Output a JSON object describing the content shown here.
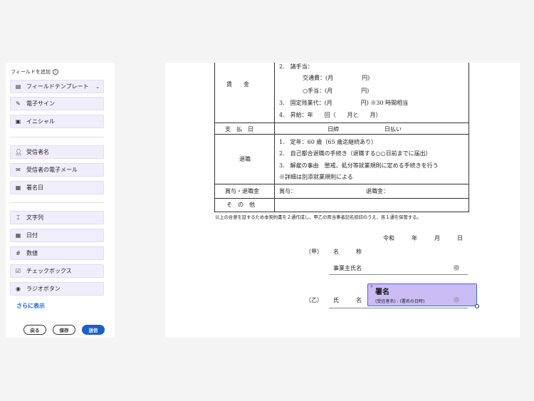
{
  "panel": {
    "title": "フィールドを追加",
    "template": "フィールドテンプレート",
    "items1": [
      "電子サイン",
      "イニシャル"
    ],
    "items2": [
      "受信者名",
      "受信者の電子メール",
      "署名日"
    ],
    "items3": [
      "文字列",
      "日付",
      "数値",
      "チェックボックス",
      "ラジオボタン"
    ],
    "more": "さらに表示",
    "back": "戻る",
    "save": "保存",
    "send": "送信",
    "accent": "#1a5fc9"
  },
  "doc": {
    "wage_label": "賃　　金",
    "wage_lines": [
      "2.　諸手当：",
      "交通費：(月　　　　　円)",
      "○手当：(月　　　　　円)",
      "3.　固定残業代：(月　　　　　円) ※30 時間相当",
      "4.　昇給：年　　回（　　月と　　月）"
    ],
    "pay_label": "支　払　日",
    "pay_close": "日締",
    "pay_day": "日払い",
    "retire_label": "退職",
    "retire_lines": [
      "1.　定年：60 歳（65 歳迄継続あり）",
      "2.　自己都合退職の手続き（退職する○○日前までに届出）",
      "3.　解雇の事由　懲戒、処分等就業規則に定める手続きを行う",
      "※詳細は別添就業規則による"
    ],
    "bonus_label": "賞与・退職金",
    "bonus": "賞与：",
    "severance": "退職金：",
    "other_label": "そ　の　他",
    "note": "以上の合意を証するため本契約書を２通作成し、甲乙の両当事者記名捺印のうえ、各１通を保管する。",
    "date": "令和　　　年　　　月　　　日",
    "party_a": "（甲）",
    "name_a": "名　　　称",
    "employer": "事業主氏名",
    "seal": "㊞",
    "party_b": "（乙）",
    "name_b": "氏　　　名"
  },
  "sig_field": {
    "required": "*",
    "title": "署名",
    "sub": "(受信者名) : (署名の日時)"
  }
}
